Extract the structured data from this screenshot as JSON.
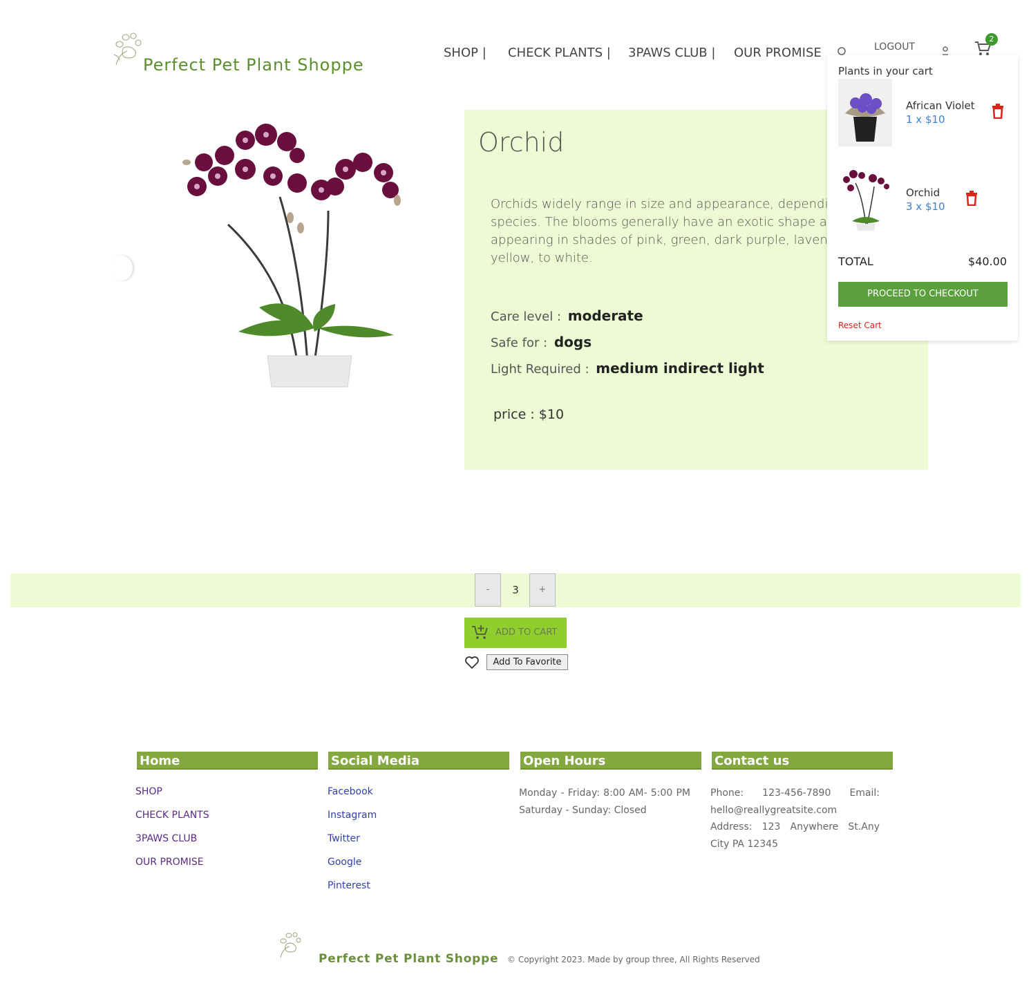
{
  "header": {
    "brand": "Perfect Pet Plant Shoppe",
    "nav": [
      "SHOP |",
      "CHECK PLANTS |",
      "3PAWS CLUB |",
      "OUR PROMISE"
    ],
    "logout": "LOGOUT",
    "cart_count": "2"
  },
  "product": {
    "name": "Orchid",
    "description": "Orchids widely range in size and appearance, depending on variety and species. The blooms generally have an exotic shape and also vary in color, appearing in shades of pink, green, dark purple, lavender, violet, blue, yellow, to white.",
    "care_label": "Care level :",
    "care_value": "moderate",
    "safe_label": "Safe for :",
    "safe_value": "dogs",
    "light_label": "Light Required :",
    "light_value": "medium indirect light",
    "price": "price : $10"
  },
  "cart": {
    "title": "Plants in your cart",
    "items": [
      {
        "name": "African Violet",
        "qty": "1 x $10"
      },
      {
        "name": "Orchid",
        "qty": "3 x $10"
      }
    ],
    "total_label": "TOTAL",
    "total_value": "$40.00",
    "checkout": "PROCEED TO CHECKOUT",
    "reset": "Reset Cart"
  },
  "purchase": {
    "minus": "-",
    "plus": "+",
    "quantity": "3",
    "add_to_cart": "ADD TO CART",
    "add_to_favorite": "Add To Favorite"
  },
  "footer": {
    "home_heading": "Home",
    "home_links": [
      "SHOP",
      "CHECK PLANTS",
      "3PAWS CLUB",
      "OUR PROMISE"
    ],
    "social_heading": "Social Media",
    "social_links": [
      "Facebook",
      "Instagram",
      "Twitter",
      "Google",
      "Pinterest"
    ],
    "hours_heading": "Open Hours",
    "hours_text": "Monday - Friday: 8:00 AM- 5:00 PM Saturday - Sunday: Closed",
    "contact_heading": "Contact us",
    "contact_text": "Phone: 123-456-7890 Email: hello@reallygreatsite.com Address: 123 Anywhere St.Any City PA 12345",
    "brand": "Perfect Pet Plant Shoppe",
    "copyright": "© Copyright 2023. Made by group three, All Rights Reserved"
  },
  "colors": {
    "brand_green": "#5a8f2a",
    "panel_bg": "#eefad4",
    "checkout_green": "#5aa03c",
    "add_cart_green": "#8fce2d",
    "footer_head": "#82a83f",
    "trash_red": "#d9261c"
  }
}
